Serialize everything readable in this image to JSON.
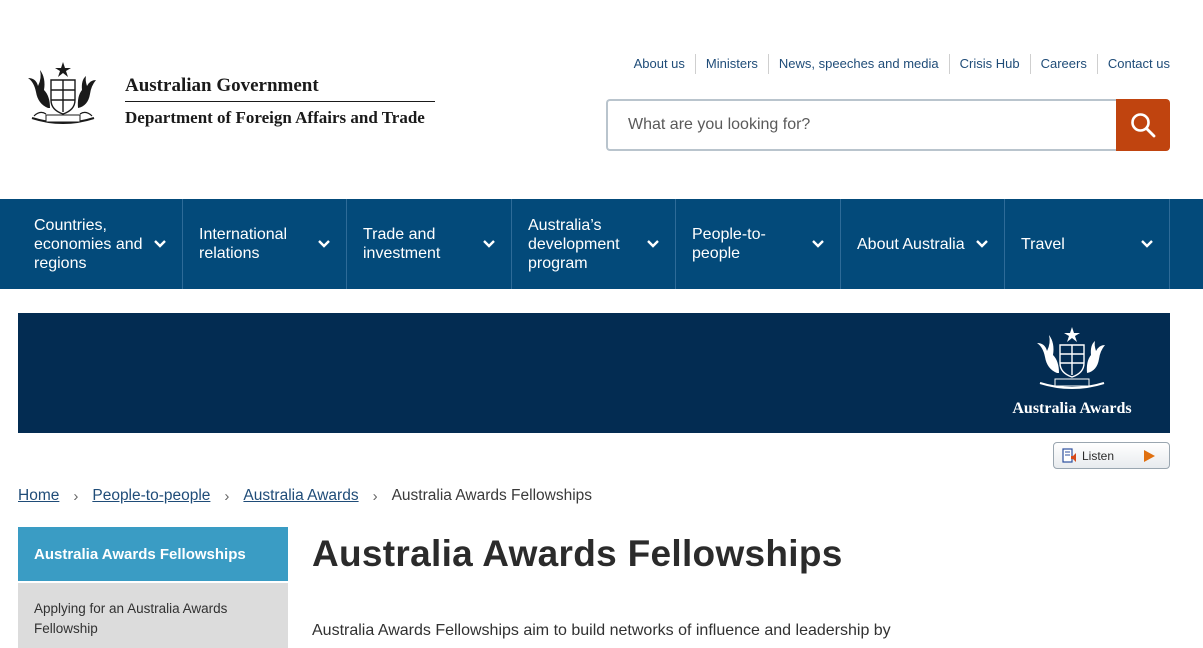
{
  "header": {
    "gov_title": "Australian Government",
    "dept_title": "Department of Foreign Affairs and Trade"
  },
  "utility_nav": [
    {
      "label": "About us"
    },
    {
      "label": "Ministers"
    },
    {
      "label": "News, speeches and media"
    },
    {
      "label": "Crisis Hub"
    },
    {
      "label": "Careers"
    },
    {
      "label": "Contact us"
    }
  ],
  "search": {
    "placeholder": "What are you looking for?",
    "icon": "search-icon"
  },
  "main_nav": [
    {
      "label": "Countries,\neconomies and\nregions"
    },
    {
      "label": "International\nrelations"
    },
    {
      "label": "Trade and\ninvestment"
    },
    {
      "label": "Australia’s\ndevelopment\nprogram"
    },
    {
      "label": "People-to-\npeople"
    },
    {
      "label": "About Australia"
    },
    {
      "label": "Travel"
    }
  ],
  "banner": {
    "logo_text": "Australia Awards"
  },
  "listen": {
    "label": "Listen"
  },
  "breadcrumb": {
    "items": [
      {
        "label": "Home"
      },
      {
        "label": "People-to-people"
      },
      {
        "label": "Australia Awards"
      }
    ],
    "current": "Australia Awards Fellowships"
  },
  "side_nav": {
    "active": "Australia Awards Fellowships",
    "items": [
      {
        "label": "Applying for an Australia Awards Fellowship"
      }
    ]
  },
  "content": {
    "title": "Australia Awards Fellowships",
    "intro": "Australia Awards Fellowships aim to build networks of influence and leadership by"
  },
  "colors": {
    "nav_bg": "#034a7a",
    "banner_bg": "#032c52",
    "search_button": "#c0440f",
    "side_active": "#3a9cc4",
    "link": "#1f4c78"
  }
}
